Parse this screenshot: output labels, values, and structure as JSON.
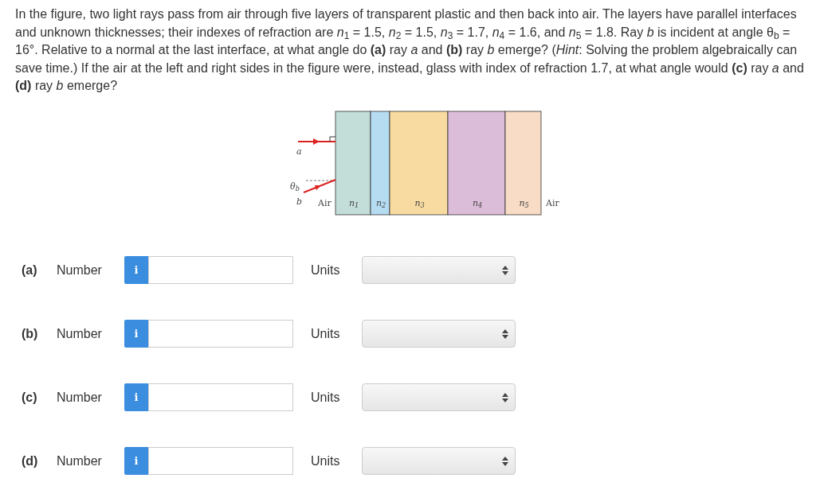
{
  "question": "In the figure, two light rays pass from air through five layers of transparent plastic and then back into air. The layers have parallel interfaces and unknown thicknesses; their indexes of refraction are *n*$_{1}$ = 1.5, *n*$_{2}$ = 1.5, *n*$_{3}$ = 1.7, *n*$_{4}$ = 1.6, and *n*$_{5}$ = 1.8. Ray *b* is incident at angle θ$_{b}$ = 16°. Relative to a normal at the last interface, at what angle do **(a)** ray *a* and **(b)** ray *b* emerge? (*Hint*: Solving the problem algebraically can save time.) If the air at the left and right sides in the figure were, instead, glass with index of refraction 1.7, at what angle would **(c)** ray *a* and **(d)** ray *b* emerge?",
  "figure": {
    "ray_a_label": "a",
    "ray_b_label": "b",
    "angle_label": "θ$_{b}$",
    "left_medium": "Air",
    "right_medium": "Air",
    "layers": [
      {
        "label": "n$_{1}$",
        "color": "#c3ddd8"
      },
      {
        "label": "n$_{2}$",
        "color": "#b6dcf2"
      },
      {
        "label": "n$_{3}$",
        "color": "#f8dba0"
      },
      {
        "label": "n$_{4}$",
        "color": "#dcbdd9"
      },
      {
        "label": "n$_{5}$",
        "color": "#f8dcc6"
      }
    ]
  },
  "answers": [
    {
      "part": "(a)",
      "label": "Number",
      "info": "i",
      "units_label": "Units"
    },
    {
      "part": "(b)",
      "label": "Number",
      "info": "i",
      "units_label": "Units"
    },
    {
      "part": "(c)",
      "label": "Number",
      "info": "i",
      "units_label": "Units"
    },
    {
      "part": "(d)",
      "label": "Number",
      "info": "i",
      "units_label": "Units"
    }
  ]
}
